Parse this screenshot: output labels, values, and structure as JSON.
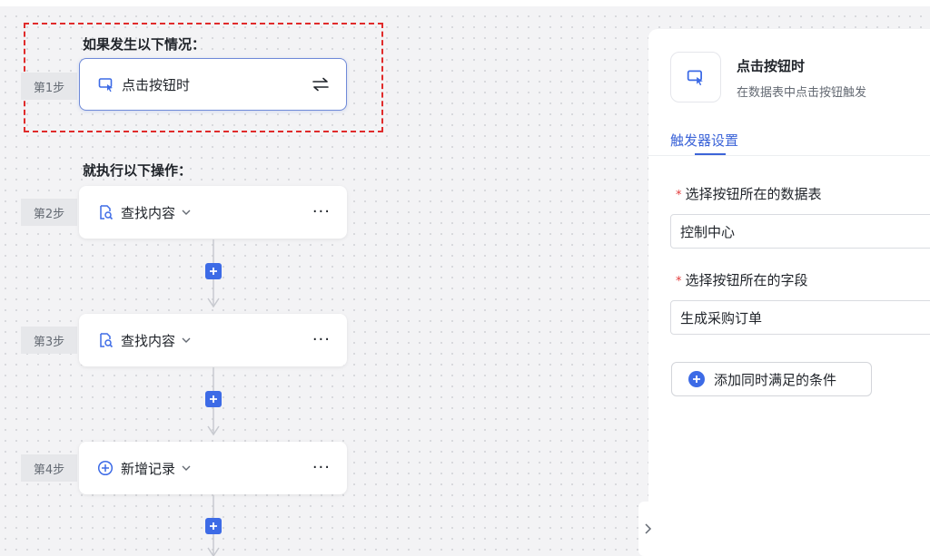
{
  "flow": {
    "trigger_heading": "如果发生以下情况：",
    "action_heading": "就执行以下操作：",
    "steps": [
      {
        "tag": "第1步",
        "label": "点击按钮时",
        "icon": "cursor-click-icon",
        "right_icon": "swap-arrows-icon"
      },
      {
        "tag": "第2步",
        "label": "查找内容",
        "icon": "find-document-icon",
        "more": "···"
      },
      {
        "tag": "第3步",
        "label": "查找内容",
        "icon": "find-document-icon",
        "more": "···"
      },
      {
        "tag": "第4步",
        "label": "新增记录",
        "icon": "add-circle-icon",
        "more": "···"
      }
    ]
  },
  "panel": {
    "icon": "cursor-click-icon",
    "title": "点击按钮时",
    "subtitle": "在数据表中点击按钮触发",
    "tab": "触发器设置",
    "fields": [
      {
        "required_mark": "*",
        "label": "选择按钮所在的数据表",
        "value": "控制中心"
      },
      {
        "required_mark": "*",
        "label": "选择按钮所在的字段",
        "value": "生成采购订单"
      }
    ],
    "add_condition_label": "添加同时满足的条件"
  },
  "colors": {
    "accent": "#3d6be6",
    "highlight_dash": "#e02b2b",
    "required": "#e23b3b",
    "tab_active": "#3c64d8"
  }
}
